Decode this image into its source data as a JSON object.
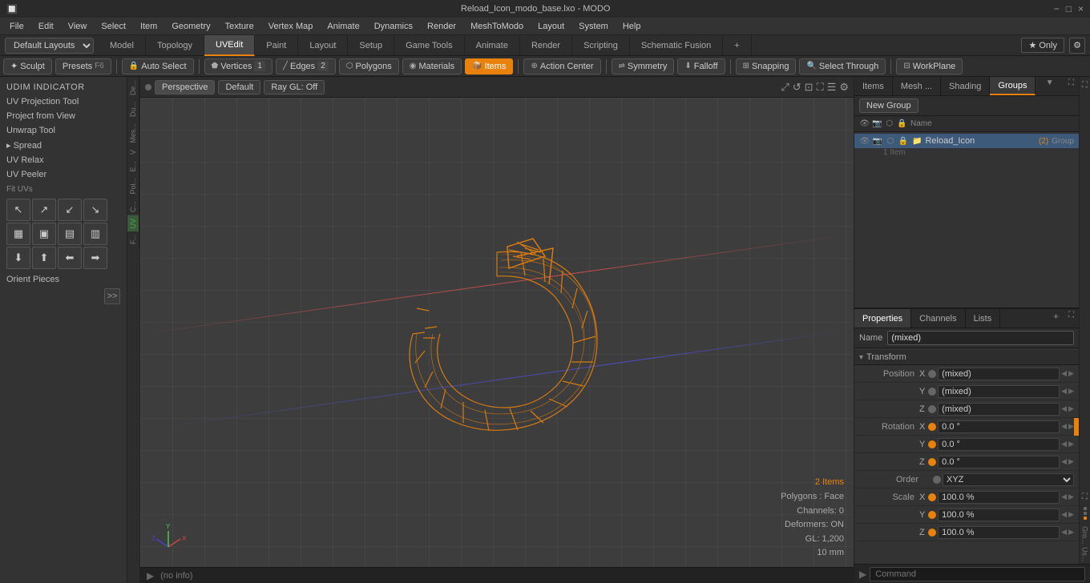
{
  "titlebar": {
    "title": "Reload_Icon_modo_base.lxo - MODO",
    "minimize": "−",
    "maximize": "□",
    "close": "×"
  },
  "menubar": {
    "items": [
      "File",
      "Edit",
      "View",
      "Select",
      "Item",
      "Geometry",
      "Texture",
      "Vertex Map",
      "Animate",
      "Dynamics",
      "Render",
      "MeshToModo",
      "Layout",
      "System",
      "Help"
    ]
  },
  "layout": {
    "selector": "Default Layouts",
    "tabs": [
      "Model",
      "Topology",
      "UVEdit",
      "Paint",
      "Layout",
      "Setup",
      "Game Tools",
      "Animate",
      "Render",
      "Scripting",
      "Schematic Fusion"
    ],
    "active_tab": "UVEdit",
    "add_tab": "+",
    "only_label": "★ Only",
    "gear_label": "⚙"
  },
  "mode_bar": {
    "sculpt_label": "✦ Sculpt",
    "presets_label": "Presets",
    "f6_key": "F6",
    "auto_select_label": "Auto Select",
    "vertices_label": "Vertices",
    "vertices_count": "1",
    "edges_label": "Edges",
    "edges_count": "2",
    "polygons_label": "Polygons",
    "materials_label": "Materials",
    "items_label": "Items",
    "action_center_label": "Action Center",
    "symmetry_label": "Symmetry",
    "falloff_label": "Falloff",
    "snapping_label": "Snapping",
    "select_through_label": "Select Through",
    "workplane_label": "WorkPlane"
  },
  "left_tools": {
    "udim_indicator": "UDIM Indicator",
    "uv_projection_tool": "UV Projection Tool",
    "project_from_view": "Project from View",
    "unwrap_tool": "Unwrap Tool",
    "spread_label": "▸ Spread",
    "uv_relax": "UV Relax",
    "uv_peeler": "UV Peeler",
    "fit_uvs": "Fit UVs",
    "orient_pieces": "Orient Pieces",
    "more_label": ">>",
    "side_labels": [
      "De...",
      "Du...",
      "Mes...",
      "V",
      "E...",
      "Pol...",
      "C...",
      "UV",
      "F..."
    ]
  },
  "viewport": {
    "perspective_label": "Perspective",
    "default_label": "Default",
    "ray_gl_label": "Ray GL: Off",
    "icons": [
      "⤢",
      "↺",
      "⊡",
      "⛶",
      "☰",
      "⚙"
    ]
  },
  "viewport_info": {
    "items_count": "2 Items",
    "polygons": "Polygons : Face",
    "channels": "Channels: 0",
    "deformers": "Deformers: ON",
    "gl": "GL: 1,200",
    "scale": "10 mm"
  },
  "right_panel": {
    "groups_tabs": [
      "Items",
      "Mesh ...",
      "Shading",
      "Groups"
    ],
    "active_groups_tab": "Groups",
    "new_group_label": "New Group",
    "columns": {
      "icons": "",
      "name": "Name"
    },
    "rows": [
      {
        "name": "Reload_Icon",
        "badge": "(2)",
        "type": "Group",
        "sub": "1 Item"
      }
    ]
  },
  "properties": {
    "tabs": [
      "Properties",
      "Channels",
      "Lists"
    ],
    "active_tab": "Properties",
    "add_btn": "+",
    "name_label": "Name",
    "name_value": "(mixed)",
    "transform_label": "Transform",
    "fields": [
      {
        "group": "Position",
        "axis": "X",
        "value": "(mixed)"
      },
      {
        "group": "",
        "axis": "Y",
        "value": "(mixed)"
      },
      {
        "group": "",
        "axis": "Z",
        "value": "(mixed)"
      },
      {
        "group": "Rotation",
        "axis": "X",
        "value": "0.0 °"
      },
      {
        "group": "",
        "axis": "Y",
        "value": "0.0 °"
      },
      {
        "group": "",
        "axis": "Z",
        "value": "0.0 °"
      },
      {
        "group": "Order",
        "axis": "",
        "value": "XYZ"
      },
      {
        "group": "Scale",
        "axis": "X",
        "value": "100.0 %"
      },
      {
        "group": "",
        "axis": "Y",
        "value": "100.0 %"
      },
      {
        "group": "",
        "axis": "Z",
        "value": "100.0 %"
      }
    ]
  },
  "status_bar": {
    "text": "(no info)"
  },
  "command_bar": {
    "placeholder": "Command",
    "icon": "▶"
  }
}
